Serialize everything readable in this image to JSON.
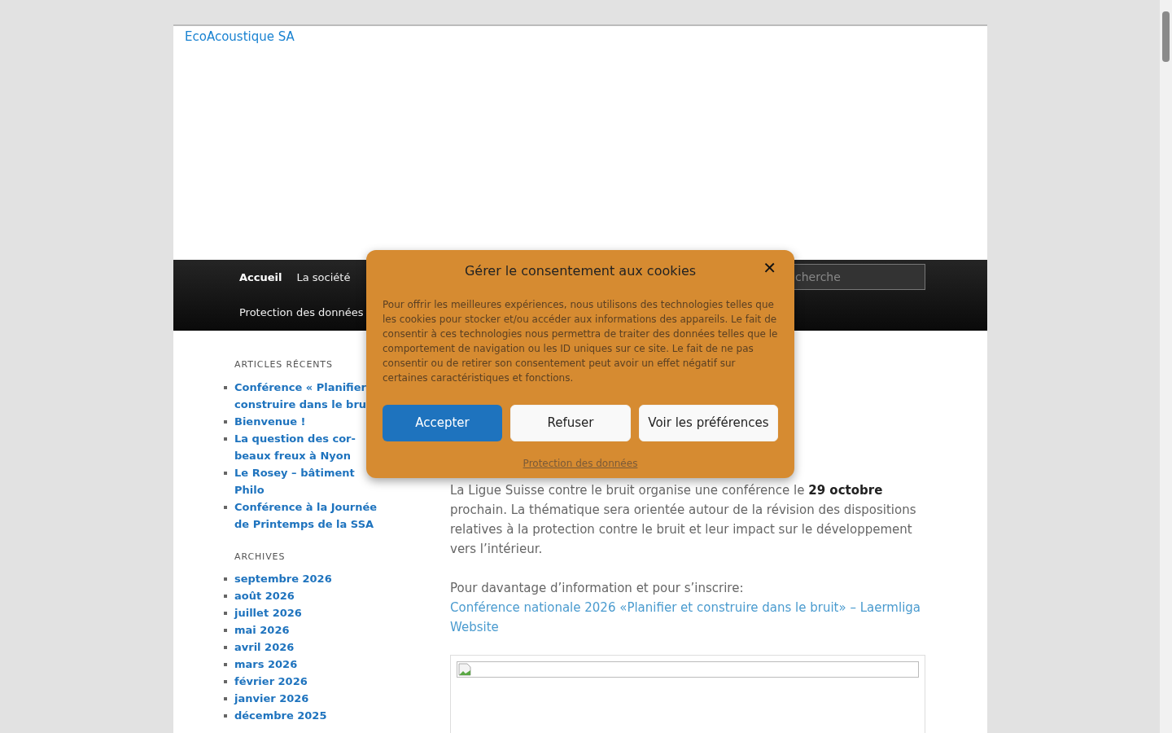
{
  "header": {
    "logo_alt": "EcoAcoustique SA"
  },
  "nav": {
    "items": [
      {
        "label": "Accueil",
        "selected": true
      },
      {
        "label": "La société",
        "selected": false
      },
      {
        "label": "Protection des données",
        "selected": false
      }
    ],
    "search": {
      "placeholder": "cherche"
    }
  },
  "sidebar": [
    {
      "title": "ARTICLES RÉCENTS",
      "items": [
        "Conférence « Planifier construire dans le bru",
        "Bienvenue !",
        "La question des cor-beaux freux à Nyon",
        "Le Rosey – bâtiment Philo",
        "Conférence à la Journée de Printemps de la SSA"
      ]
    },
    {
      "title": "ARCHIVES",
      "items": [
        "septembre 2026",
        "août 2026",
        "juillet 2026",
        "mai 2026",
        "avril 2026",
        "mars 2026",
        "février 2026",
        "janvier 2026",
        "décembre 2025"
      ]
    }
  ],
  "article": {
    "paragraphs": [
      {
        "text": "La Ligue Suisse contre le bruit organise une conférence le **29 octobre** prochain. La thématique sera orientée autour de la révision des dispositions relatives à la protection contre le bruit et leur impact sur le développement vers l’intérieur."
      },
      {
        "text": "Pour davantage d’information et pour s’inscrire:",
        "link": "Conférence nationale 2026 «Planifier et construire dans le bruit» – Laermliga Website"
      }
    ],
    "figure": {
      "kind": "broken-image"
    }
  },
  "cookie_dialog": {
    "title": "Gérer le consentement aux cookies",
    "close": "✕",
    "body": "Pour offrir les meilleures expériences, nous utilisons des technologies telles que les cookies pour stocker et/ou accéder aux informations des appareils. Le fait de consentir à ces technologies nous permettra de traiter des données telles que le comportement de navigation ou les ID uniques sur ce site. Le fait de ne pas consentir ou de retirer son consentement peut avoir un effet négatif sur certaines caractéristiques et fonctions.",
    "buttons": [
      {
        "label": "Accepter",
        "kind": "primary"
      },
      {
        "label": "Refuser",
        "kind": "secondary"
      },
      {
        "label": "Voir les préférences",
        "kind": "secondary"
      }
    ],
    "link": "Protection des données"
  }
}
